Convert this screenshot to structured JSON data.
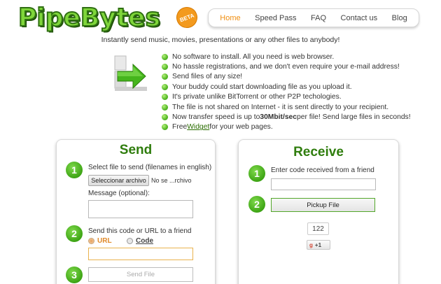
{
  "brand": {
    "name": "PipeBytes",
    "badge": "BETA"
  },
  "nav": [
    {
      "label": "Home",
      "active": true
    },
    {
      "label": "Speed Pass"
    },
    {
      "label": "FAQ"
    },
    {
      "label": "Contact us"
    },
    {
      "label": "Blog"
    }
  ],
  "tagline": "Instantly send music, movies, presentations or any other files to anybody!",
  "features": {
    "f0": "No software to install. All you need is web browser.",
    "f1": "No hassle registrations, and we don't even require your e-mail address!",
    "f2": "Send files of any size!",
    "f3": "Your buddy could start downloading file as you upload it.",
    "f4": "It's private unlike BitTorrent or other P2P techologies.",
    "f5": "The file is not shared on Internet - it is sent directly to your recipient.",
    "f6_pre": "Now transfer speed is up to ",
    "f6_bold": "30Mbit/sec",
    "f6_post": " per file! Send large files in seconds!",
    "f7_pre": "Free ",
    "f7_link": "Widget",
    "f7_post": " for your web pages."
  },
  "send": {
    "title": "Send",
    "step1": "1",
    "step1_label": "Select file to send (filenames in english)",
    "file_button": "Seleccionar archivo",
    "file_name": "No se ...rchivo",
    "message_label": "Message (optional):",
    "step2": "2",
    "step2_label": "Send this code or URL to a friend",
    "radio_url": "URL",
    "radio_code": "Code",
    "step3": "3",
    "send_button": "Send File"
  },
  "receive": {
    "title": "Receive",
    "step1": "1",
    "step1_label": "Enter code received from a friend",
    "step2": "2",
    "pickup_button": "Pickup File",
    "count": "122",
    "gplus_label": "+1",
    "gplus_g": "g"
  },
  "colors": {
    "accent_green": "#2f7d0d",
    "nav_active": "#f08f12",
    "step_green": "#3ea515"
  }
}
